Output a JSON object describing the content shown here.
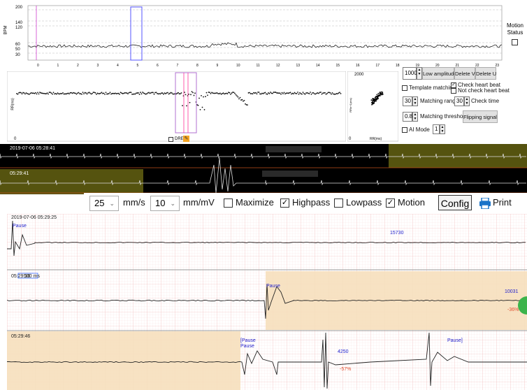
{
  "trend": {
    "ylabel": "BPM",
    "yticks": [
      "200",
      "140",
      "120",
      "60",
      "50",
      "30"
    ],
    "xticks": [
      "0",
      "1",
      "2",
      "3",
      "4",
      "5",
      "6",
      "7",
      "8",
      "9",
      "10",
      "11",
      "12",
      "13",
      "14",
      "15",
      "16",
      "17",
      "18",
      "19",
      "20",
      "21",
      "22",
      "23"
    ],
    "motion_status": "Motion Status"
  },
  "rr_panel": {
    "ylabel": "RR(ms)",
    "xstart": "0",
    "dre_label": "DRE"
  },
  "scatter": {
    "ylabel": "RRn+1(ms)",
    "xlabel": "RR(ms)",
    "ytop": "2000",
    "origin": "0"
  },
  "controls": {
    "amplitude_value": "1000",
    "low_amplitude": "Low amplitude",
    "delete_v": "Delete V",
    "delete_u": "Delete U",
    "template_matching": "Template matching",
    "check_heart_beat": "Check heart beat",
    "not_check_heart_beat": "Not check heart beat",
    "matching_range_value": "30",
    "matching_range": "Matching range",
    "check_time_value": "30",
    "check_time": "Check time",
    "threshold_value": "0.8",
    "matching_threshold": "Matching threshold",
    "flipping_signal": "Flipping signal",
    "ai_mode": "AI Mode",
    "ai_mode_value": "1"
  },
  "strips": {
    "strip1_time": "2019-07-06 05:28:41",
    "strip2_time": "05:29:41"
  },
  "toolbar": {
    "speed_value": "25",
    "speed_unit": "mm/s",
    "gain_value": "10",
    "gain_unit": "mm/mV",
    "maximize": "Maximize",
    "highpass": "Highpass",
    "lowpass": "Lowpass",
    "motion": "Motion",
    "config": "Config",
    "print": "Print"
  },
  "ecg": {
    "row1_time": "2019-07-06 05:29:25",
    "row1_pause": "Pause",
    "row1_value": "15730",
    "row2_time": "05:29:36",
    "row2_scale": "500 ms",
    "row2_pause": "Pause",
    "row2_value": "10031",
    "row2_pct": "-36%",
    "row3_time": "05:29:46",
    "row3_pause_a": "[Pause",
    "row3_pause_b": "Pause",
    "row3_value": "4250",
    "row3_pct": "-57%",
    "row3_pause_c": "Pause]"
  },
  "colors": {
    "pink_grid": "#f5c4c4",
    "pause_fill": "#f6dfbd",
    "strip_bg": "#000000",
    "strip_highlight": "#55530f",
    "annotation_blue": "#2222cc",
    "pct_red": "#e05030"
  }
}
